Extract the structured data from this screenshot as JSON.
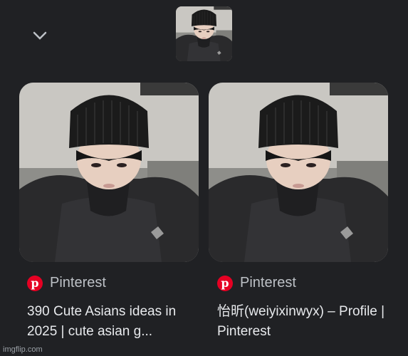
{
  "icons": {
    "collapse": "chevron-down-icon",
    "source": "pinterest-icon"
  },
  "results": [
    {
      "source": "Pinterest",
      "title": "390 Cute Asians ideas in 2025 | cute asian g..."
    },
    {
      "source": "Pinterest",
      "title": "怡昕(weiyixinwyx) – Profile | Pinterest"
    }
  ],
  "watermark": "imgflip.com",
  "colors": {
    "background": "#202124",
    "pinterest": "#e60023",
    "text": "#e8eaed",
    "muted": "#bdc1c6"
  }
}
